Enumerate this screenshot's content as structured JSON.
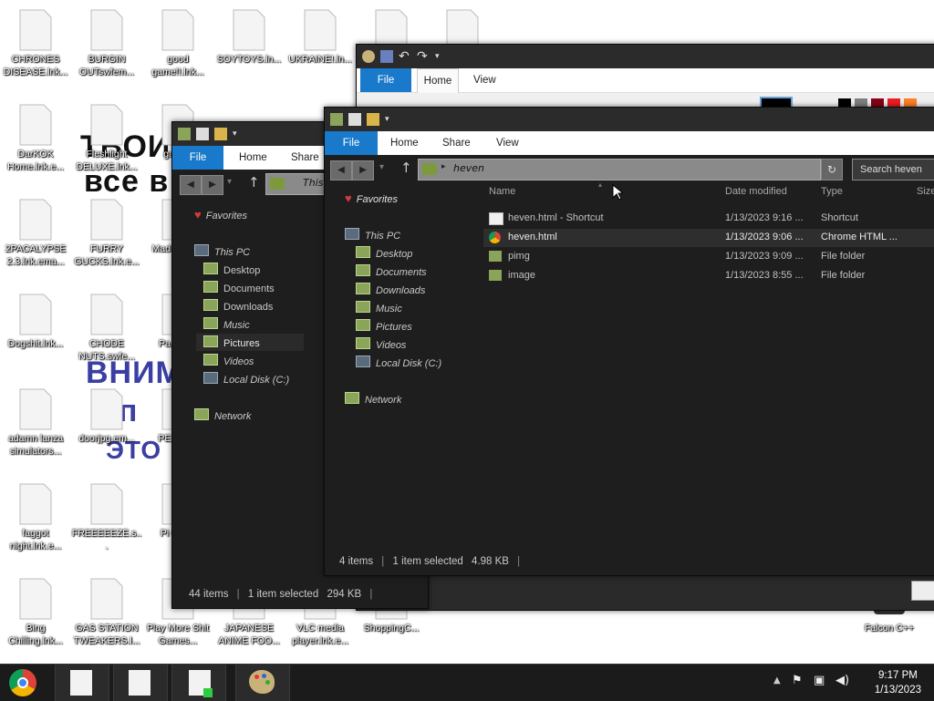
{
  "desktop": {
    "background_text": [
      "ТВОИ",
      "все в",
      "ВНИМ",
      "ап",
      "ЭТО"
    ],
    "icons": [
      {
        "label": "CHRONES DISEASE.lnk..."
      },
      {
        "label": "BURGIN OUTswfem..."
      },
      {
        "label": "good game!!.lnk..."
      },
      {
        "label": "SOYTOYS.ln..."
      },
      {
        "label": "UKRAINE!.ln..."
      },
      {
        "label": "DarKOK Home.lnk.e..."
      },
      {
        "label": "Fleshlight DELUXE.lnk..."
      },
      {
        "label": "games"
      },
      {
        "label": "2PACALYPSE 2.3.lnk.ema..."
      },
      {
        "label": "FURRY GUCKS.lnk.e..."
      },
      {
        "label": "Mad IN SPA"
      },
      {
        "label": "Dogshit.lnk..."
      },
      {
        "label": "CHODE NUTS.swfe..."
      },
      {
        "label": "Pa Pleas"
      },
      {
        "label": "adamn lanza simulators..."
      },
      {
        "label": "doorjpg.em..."
      },
      {
        "label": "PE WIFE"
      },
      {
        "label": "faggot night.lnk.e..."
      },
      {
        "label": "FREEEEEZE.s..."
      },
      {
        "label": "Pi Chick"
      },
      {
        "label": "Bing Chilling.lnk..."
      },
      {
        "label": "GAS STATION TWEAKERS.l..."
      },
      {
        "label": "Play More Shit Games..."
      },
      {
        "label": "JAPANESE ANIME FOO..."
      },
      {
        "label": "VLC media player.lnk.e..."
      },
      {
        "label": "ShoppingC..."
      },
      {
        "label": "Falcon C++"
      }
    ]
  },
  "paint_window": {
    "ribbon_tabs": [
      "File",
      "Home",
      "View"
    ]
  },
  "explorer_back": {
    "ribbon_tabs": [
      "File",
      "Home",
      "Share"
    ],
    "address": "This",
    "nav": {
      "favorites": "Favorites",
      "this_pc": "This PC",
      "items": [
        "Desktop",
        "Documents",
        "Downloads",
        "Music",
        "Pictures",
        "Videos",
        "Local Disk (C:)"
      ],
      "network": "Network"
    },
    "status": {
      "count": "44 items",
      "selected": "1 item selected",
      "size": "294 KB"
    }
  },
  "explorer_front": {
    "ribbon_tabs": [
      "File",
      "Home",
      "Share",
      "View"
    ],
    "address": "heven",
    "search_placeholder": "Search heven",
    "nav": {
      "favorites": "Favorites",
      "this_pc": "This PC",
      "items": [
        "Desktop",
        "Documents",
        "Downloads",
        "Music",
        "Pictures",
        "Videos",
        "Local Disk (C:)"
      ],
      "network": "Network"
    },
    "columns": {
      "name": "Name",
      "date": "Date modified",
      "type": "Type",
      "size": "Size"
    },
    "files": [
      {
        "name": "heven.html - Shortcut",
        "date": "1/13/2023 9:16 ...",
        "type": "Shortcut",
        "icon": "shortcut-icon"
      },
      {
        "name": "heven.html",
        "date": "1/13/2023 9:06 ...",
        "type": "Chrome HTML ...",
        "icon": "chrome-icon"
      },
      {
        "name": "pimg",
        "date": "1/13/2023 9:09 ...",
        "type": "File folder",
        "icon": "folder-icon"
      },
      {
        "name": "image",
        "date": "1/13/2023 8:55 ...",
        "type": "File folder",
        "icon": "folder-icon"
      }
    ],
    "status": {
      "count": "4 items",
      "selected": "1 item selected",
      "size": "4.98 KB"
    }
  },
  "taskbar": {
    "time": "9:17 PM",
    "date": "1/13/2023"
  },
  "colors": {
    "ribbon_file": "#1979ca",
    "window_bg": "#1e1e1e",
    "taskbar_bg": "#1b1b1b"
  }
}
